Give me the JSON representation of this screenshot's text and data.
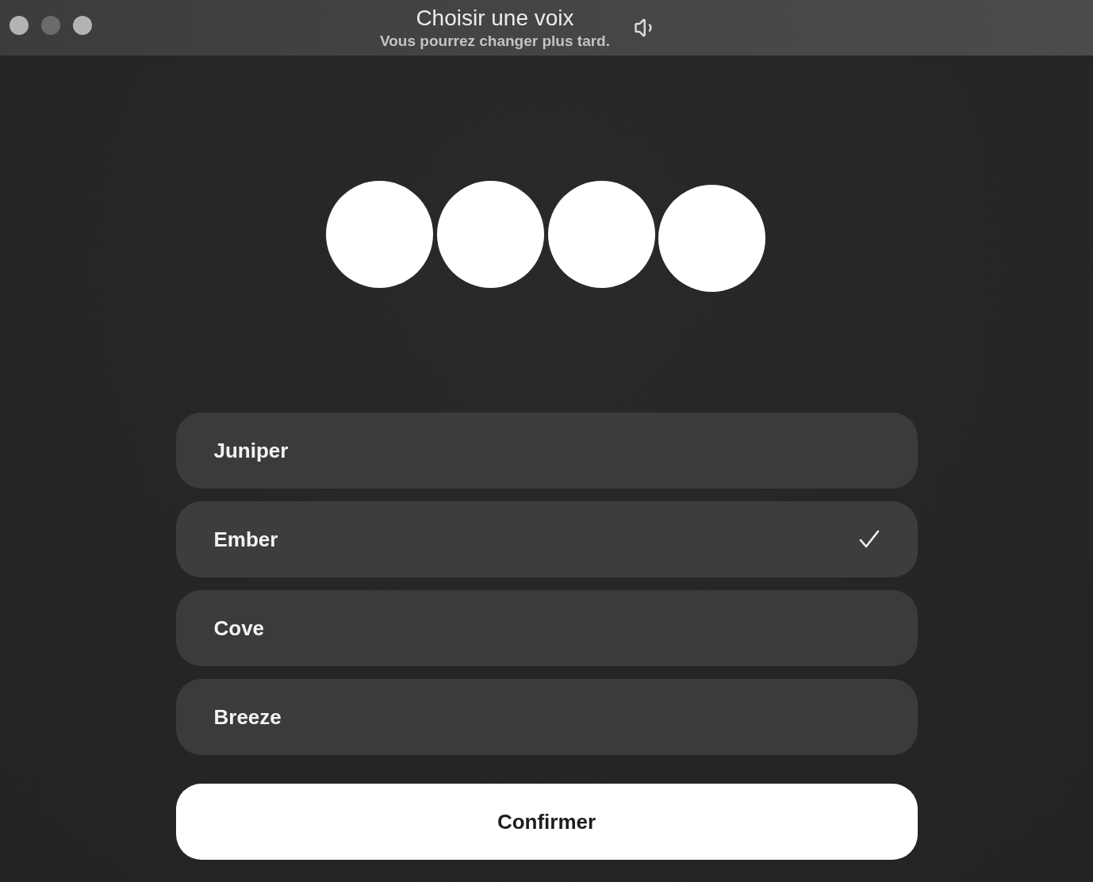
{
  "window": {
    "title": "Choisir une voix",
    "subtitle": "Vous pourrez changer plus tard."
  },
  "voices": [
    {
      "name": "Juniper",
      "selected": false
    },
    {
      "name": "Ember",
      "selected": true
    },
    {
      "name": "Cove",
      "selected": false
    },
    {
      "name": "Breeze",
      "selected": false
    }
  ],
  "confirm_button": "Confirmer"
}
